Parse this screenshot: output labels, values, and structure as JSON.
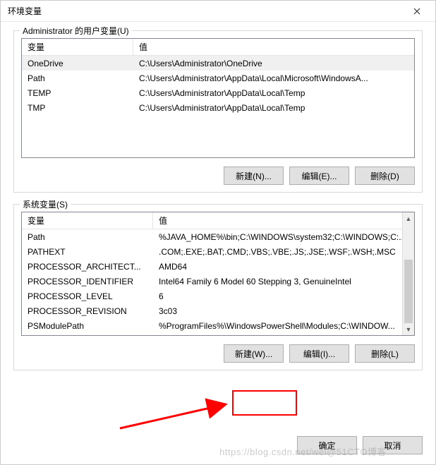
{
  "window": {
    "title": "环境变量"
  },
  "user_section": {
    "label": "Administrator 的用户变量(U)",
    "columns": {
      "name": "变量",
      "value": "值"
    },
    "rows": [
      {
        "name": "OneDrive",
        "value": "C:\\Users\\Administrator\\OneDrive"
      },
      {
        "name": "Path",
        "value": "C:\\Users\\Administrator\\AppData\\Local\\Microsoft\\WindowsA..."
      },
      {
        "name": "TEMP",
        "value": "C:\\Users\\Administrator\\AppData\\Local\\Temp"
      },
      {
        "name": "TMP",
        "value": "C:\\Users\\Administrator\\AppData\\Local\\Temp"
      }
    ],
    "buttons": {
      "new": "新建(N)...",
      "edit": "编辑(E)...",
      "delete": "删除(D)"
    }
  },
  "system_section": {
    "label": "系统变量(S)",
    "columns": {
      "name": "变量",
      "value": "值"
    },
    "rows": [
      {
        "name": "Path",
        "value": "%JAVA_HOME%\\bin;C:\\WINDOWS\\system32;C:\\WINDOWS;C:..."
      },
      {
        "name": "PATHEXT",
        "value": ".COM;.EXE;.BAT;.CMD;.VBS;.VBE;.JS;.JSE;.WSF;.WSH;.MSC"
      },
      {
        "name": "PROCESSOR_ARCHITECT...",
        "value": "AMD64"
      },
      {
        "name": "PROCESSOR_IDENTIFIER",
        "value": "Intel64 Family 6 Model 60 Stepping 3, GenuineIntel"
      },
      {
        "name": "PROCESSOR_LEVEL",
        "value": "6"
      },
      {
        "name": "PROCESSOR_REVISION",
        "value": "3c03"
      },
      {
        "name": "PSModulePath",
        "value": "%ProgramFiles%\\WindowsPowerShell\\Modules;C:\\WINDOW..."
      }
    ],
    "buttons": {
      "new": "新建(W)...",
      "edit": "编辑(I)...",
      "delete": "删除(L)"
    }
  },
  "footer": {
    "ok": "确定",
    "cancel": "取消"
  },
  "watermark": "https://blog.csdn.net/wei@51CTO博客",
  "annotation": {
    "highlight_color": "#ff0000"
  }
}
